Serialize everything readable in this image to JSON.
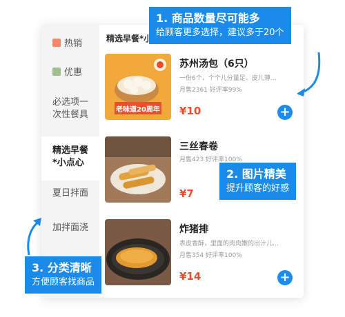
{
  "sidebar": {
    "items": [
      {
        "label": "热销",
        "icon": "fire-icon"
      },
      {
        "label": "优惠",
        "icon": "discount-icon"
      },
      {
        "label": "必选项一次性餐具"
      },
      {
        "label": "精选早餐*小点心"
      },
      {
        "label": "夏日拌面"
      },
      {
        "label": "加拌面浇"
      }
    ],
    "active_index": 3
  },
  "header": {
    "title": "精选早餐*小点心"
  },
  "items": [
    {
      "name": "苏州汤包（6只）",
      "desc": "一份6个，个个儿分量足、皮儿薄…",
      "sales": "月售2361  好评率99%",
      "price": "¥10",
      "badge": "老味道20周年"
    },
    {
      "name": "三丝春卷",
      "desc": "",
      "sales": "月售423  好评率100%",
      "price": "¥7"
    },
    {
      "name": "炸猪排",
      "desc": "表皮香酥，里面的肉肉嫩的出汁儿…",
      "sales": "月售354  好评率100%",
      "price": "¥14"
    }
  ],
  "callouts": {
    "c1": {
      "title": "1. 商品数量尽可能多",
      "sub": "给顾客更多选择，建议多于20个"
    },
    "c2": {
      "title": "2. 图片精美",
      "sub": "提升顾客的好感"
    },
    "c3": {
      "title": "3. 分类清晰",
      "sub": "方便顾客找商品"
    }
  },
  "colors": {
    "accent": "#1a8be8",
    "price": "#e8502d"
  }
}
